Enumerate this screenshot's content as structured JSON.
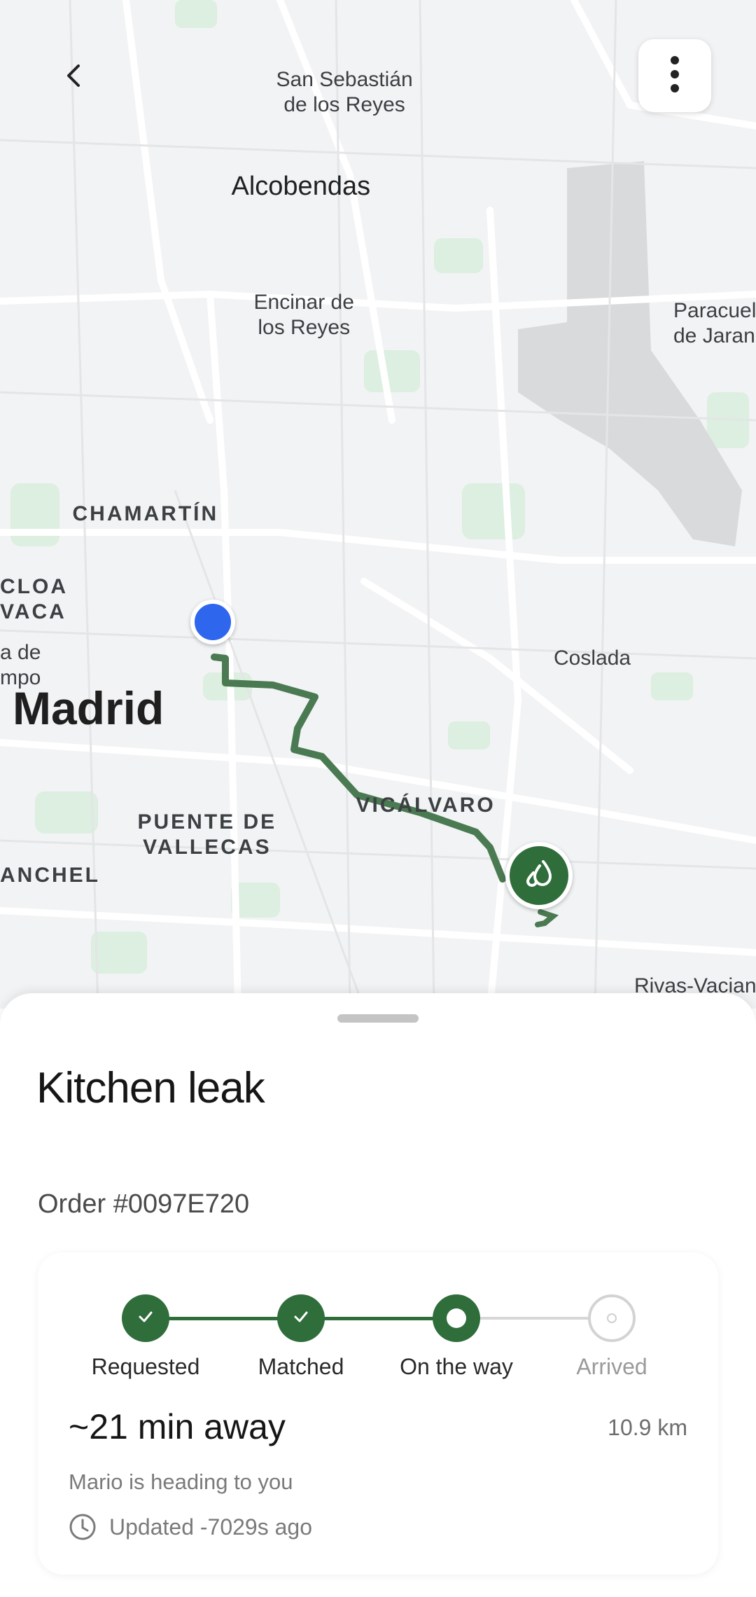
{
  "map": {
    "labels": {
      "san_sebastian": "San Sebastián\nde los Reyes",
      "alcobendas": "Alcobendas",
      "encinar": "Encinar de\nlos Reyes",
      "paracuellos": "Paracuel\nde Jaran",
      "chamartin": "CHAMARTÍN",
      "moncloa": "CLOA\nVACA",
      "casa_de_campo": "a de\nmpo",
      "madrid": "Madrid",
      "coslada": "Coslada",
      "vicalvaro": "VICÁLVARO",
      "puente_de_vallecas": "PUENTE DE\nVALLECAS",
      "carabanchel": "ANCHEL",
      "rivas": "Rivas-Vacian"
    },
    "route_color": "#4a7a52",
    "user_dot_color": "#2f66ee",
    "pro_pin_icon": "water-drop-icon"
  },
  "header": {
    "back_icon": "chevron-left-icon",
    "menu_icon": "more-vertical-icon"
  },
  "sheet": {
    "title": "Kitchen leak",
    "order": "Order #0097E720",
    "steps": [
      {
        "label": "Requested",
        "state": "done"
      },
      {
        "label": "Matched",
        "state": "done"
      },
      {
        "label": "On the way",
        "state": "current"
      },
      {
        "label": "Arrived",
        "state": "pending"
      }
    ],
    "eta": "~21 min away",
    "distance": "10.9 km",
    "subtitle": "Mario is heading to you",
    "updated": "Updated -7029s ago",
    "accent_color": "#2f6d3b"
  }
}
